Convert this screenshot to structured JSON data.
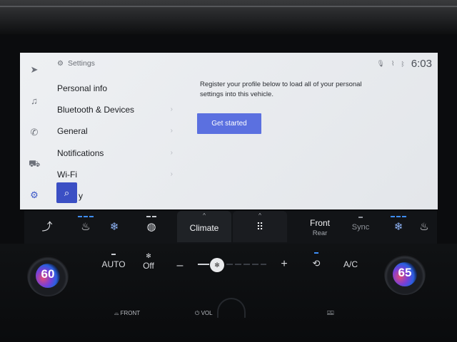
{
  "screen": {
    "header": {
      "title": "Settings"
    },
    "status": {
      "time": "6:03"
    },
    "menu": [
      {
        "label": "Personal info"
      },
      {
        "label": "Bluetooth & Devices"
      },
      {
        "label": "General"
      },
      {
        "label": "Notifications"
      },
      {
        "label": "Wi-Fi"
      },
      {
        "label": "y"
      }
    ],
    "message": "Register your profile below to load all of your personal settings into this vehicle.",
    "button": {
      "label": "Get started"
    }
  },
  "climate_bar": {
    "tab_climate": "Climate",
    "front_label": "Front",
    "rear_label": "Rear",
    "sync_label": "Sync"
  },
  "climate_panel": {
    "left_temp": "60",
    "right_temp": "65",
    "auto_label": "AUTO",
    "fan_label": "Off",
    "minus": "–",
    "plus": "+",
    "ac_label": "A/C",
    "fan_level": 0
  },
  "hard_buttons": {
    "front": "FRONT",
    "vol": "VOL"
  },
  "colors": {
    "accent": "#3b4fc4",
    "button": "#5b70e0",
    "indicator_blue": "#3e8ef7"
  },
  "icons": {
    "rail": [
      "navigation-icon",
      "music-icon",
      "phone-icon",
      "car-icon",
      "gear-icon"
    ],
    "search": "search-icon"
  }
}
